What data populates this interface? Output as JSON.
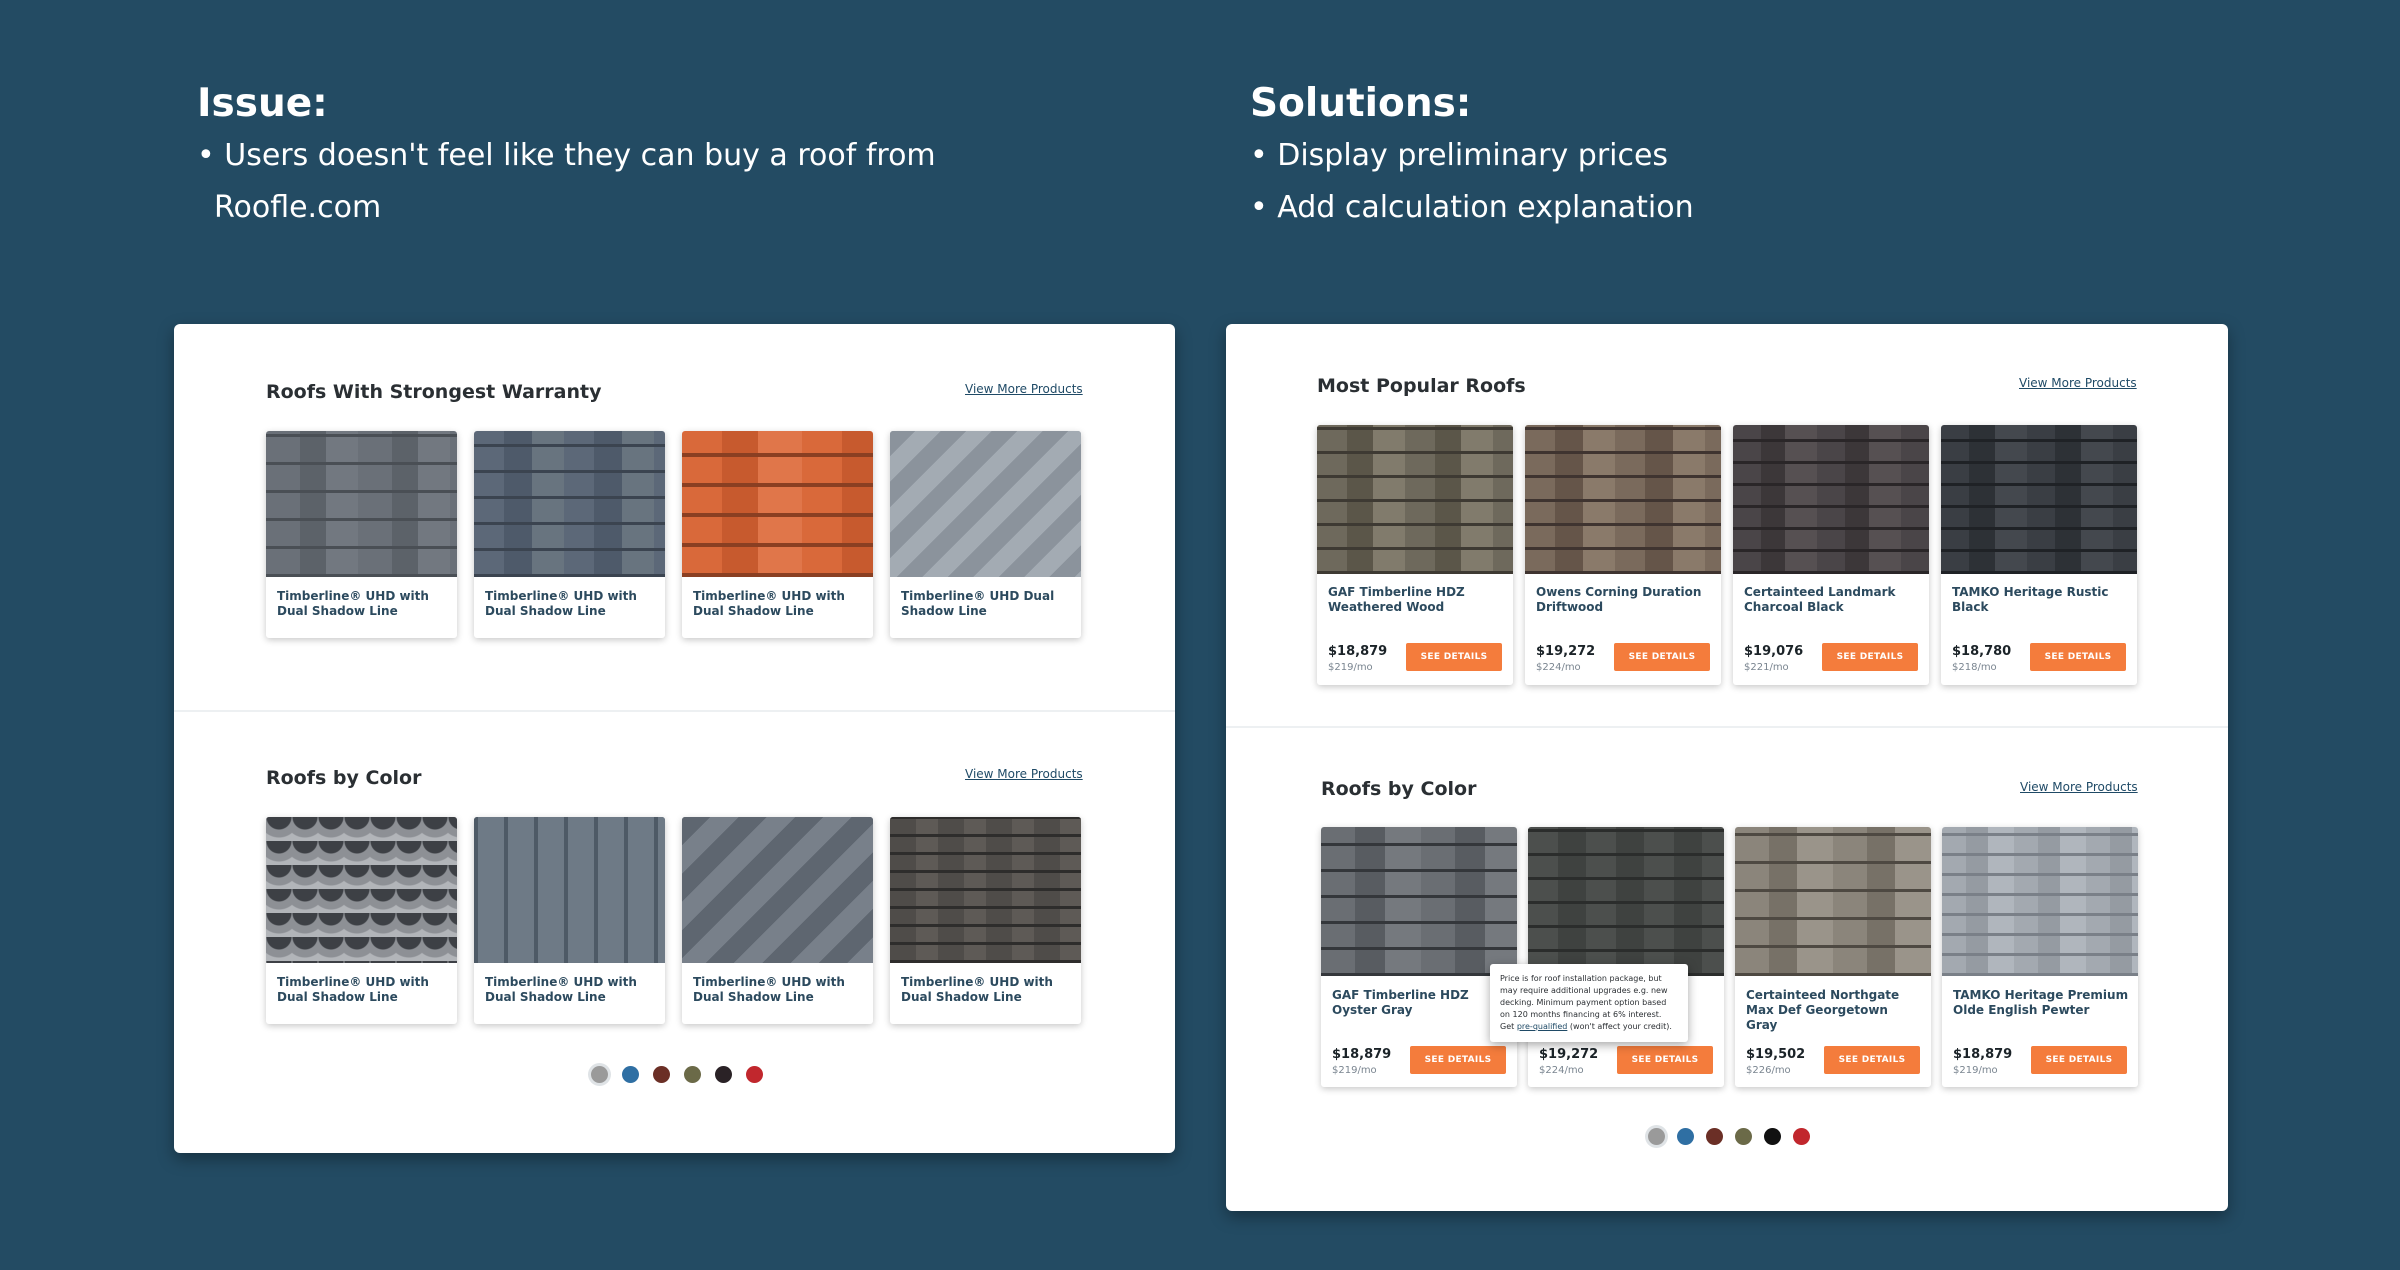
{
  "issue": {
    "title": "Issue:",
    "line1": "• Users doesn't feel like they can buy a roof from",
    "line2": "Roofle.com"
  },
  "solutions": {
    "title": "Solutions:",
    "line1": "• Display preliminary prices",
    "line2": "• Add calculation explanation"
  },
  "left_panel": {
    "warranty": {
      "title": "Roofs With Strongest Warranty",
      "view_more": "View More Products",
      "cards": [
        {
          "name": "Timberline® UHD with Dual Shadow Line",
          "texture": "gray"
        },
        {
          "name": "Timberline® UHD with Dual Shadow Line",
          "texture": "cracked"
        },
        {
          "name": "Timberline® UHD with Dual Shadow Line",
          "texture": "orange"
        },
        {
          "name": "Timberline® UHD  Dual Shadow Line",
          "texture": "zig"
        }
      ]
    },
    "color": {
      "title": "Roofs by Color",
      "view_more": "View More Products",
      "cards": [
        {
          "name": "Timberline® UHD with Dual Shadow Line",
          "texture": "scale"
        },
        {
          "name": "Timberline® UHD with Dual Shadow Line",
          "texture": "metal"
        },
        {
          "name": "Timberline® UHD with Dual Shadow Line",
          "texture": "slate"
        },
        {
          "name": "Timberline® UHD with Dual Shadow Line",
          "texture": "dark"
        }
      ],
      "swatches": [
        "#9a9a9a",
        "#2f6fa3",
        "#6b2f26",
        "#6b6a48",
        "#2a2226",
        "#c1272d"
      ]
    }
  },
  "right_panel": {
    "popular": {
      "title": "Most Popular Roofs",
      "view_more": "View More Products",
      "cards": [
        {
          "name": "GAF Timberline HDZ Weathered Wood",
          "price": "$18,879",
          "monthly": "$219/mo",
          "button": "SEE DETAILS",
          "texture": "weathered"
        },
        {
          "name": "Owens Corning Duration Driftwood",
          "price": "$19,272",
          "monthly": "$224/mo",
          "button": "SEE DETAILS",
          "texture": "driftwood"
        },
        {
          "name": "Certainteed Landmark Charcoal Black",
          "price": "$19,076",
          "monthly": "$221/mo",
          "button": "SEE DETAILS",
          "texture": "charcoal"
        },
        {
          "name": "TAMKO Heritage Rustic Black",
          "price": "$18,780",
          "monthly": "$218/mo",
          "button": "SEE DETAILS",
          "texture": "black"
        }
      ]
    },
    "color": {
      "title": "Roofs by Color",
      "view_more": "View More Products",
      "cards": [
        {
          "name": "GAF Timberline HDZ Oyster Gray",
          "price": "$18,879",
          "monthly": "$219/mo",
          "button": "SEE DETAILS",
          "texture": "oyster"
        },
        {
          "name": "",
          "price": "$19,272",
          "monthly": "$224/mo",
          "button": "SEE DETAILS",
          "texture": "dark2"
        },
        {
          "name": "Certainteed Northgate Max Def Georgetown Gray",
          "price": "$19,502",
          "monthly": "$226/mo",
          "button": "SEE DETAILS",
          "texture": "georgetown"
        },
        {
          "name": "TAMKO Heritage Premium Olde English Pewter",
          "price": "$18,879",
          "monthly": "$219/mo",
          "button": "SEE DETAILS",
          "texture": "pewter"
        }
      ],
      "swatches": [
        "#9a9a9a",
        "#2f6fa3",
        "#6b2f26",
        "#6b6a48",
        "#111111",
        "#c1272d"
      ]
    },
    "tooltip": {
      "text": "Price is for roof installation package, but may require additional upgrades e.g. new decking. Minimum payment option based on 120 months financing at 6% interest.",
      "get": "Get",
      "link": "pre-qualified",
      "tail": "(won't affect your credit)."
    }
  },
  "colors": {
    "background": "#234b63",
    "accent": "#f47c3c"
  }
}
